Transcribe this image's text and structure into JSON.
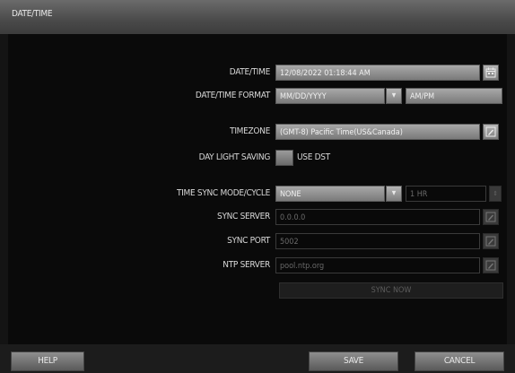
{
  "window": {
    "title": "DATE/TIME"
  },
  "form": {
    "datetime": {
      "label": "DATE/TIME",
      "value": "12/08/2022 01:18:44 AM",
      "icon": "calendar-icon"
    },
    "format": {
      "label": "DATE/TIME FORMAT",
      "date_value": "MM/DD/YYYY",
      "time_value": "AM/PM"
    },
    "timezone": {
      "label": "TIMEZONE",
      "value": "(GMT-8) Pacific Time(US&Canada)",
      "icon": "edit-icon"
    },
    "dst": {
      "label": "DAY LIGHT SAVING",
      "option_label": "USE DST"
    },
    "sync_mode": {
      "label": "TIME SYNC MODE/CYCLE",
      "mode_value": "NONE",
      "cycle_value": "1 HR"
    },
    "sync_server": {
      "label": "SYNC SERVER",
      "value": "0.0.0.0"
    },
    "sync_port": {
      "label": "SYNC PORT",
      "value": "5002"
    },
    "ntp_server": {
      "label": "NTP SERVER",
      "value": "pool.ntp.org"
    },
    "sync_now_label": "SYNC NOW"
  },
  "footer": {
    "help_label": "HELP",
    "save_label": "SAVE",
    "cancel_label": "CANCEL"
  },
  "icons": {
    "dropdown": "chevron-down-icon",
    "spinner": "up-down-icon",
    "edit": "edit-icon"
  }
}
